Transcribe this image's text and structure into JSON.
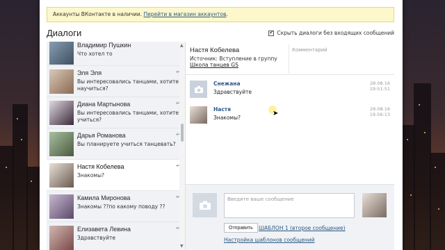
{
  "notice": {
    "text": "Аккаунты ВКонтакте в наличии. ",
    "link": "Перейти в магазин аккаунтов",
    "tail": "."
  },
  "header": {
    "title": "Диалоги",
    "hide_toggle_label": "Скрыть диалоги без входящих сообщений",
    "hide_toggle_checked": true
  },
  "dialogs": [
    {
      "name": "Владимир Пушкин",
      "preview": "Что хотел то",
      "reply_icon": false
    },
    {
      "name": "Эля Эля",
      "preview": "Вы интересовались танцами, хотите научиться?",
      "reply_icon": true
    },
    {
      "name": "Диана Мартынова",
      "preview": "Вы интересовались танцами, хотите учиться?",
      "reply_icon": true
    },
    {
      "name": "Дарья Романова",
      "preview": "Вы планируете учиться танцевать?",
      "reply_icon": true
    },
    {
      "name": "Настя Кобелева",
      "preview": "Знакомы?",
      "reply_icon": true,
      "active": true
    },
    {
      "name": "Камила Миронова",
      "preview": "Знакомы ??по какому поводу ??",
      "reply_icon": true
    },
    {
      "name": "Елизавета Левина",
      "preview": "Здравствуйте",
      "reply_icon": true
    }
  ],
  "conversation": {
    "contact_name": "Настя Кобелева",
    "source_prefix": "Источник: Вступление в группу ",
    "source_link": "Школа танцев GS",
    "comment_placeholder": "Комментарий",
    "messages": [
      {
        "author": "Снежана",
        "text": "Здравствуйте",
        "date": "28.08.16",
        "time": "19:51:51"
      },
      {
        "author": "Настя",
        "text": "Знакомы?",
        "date": "28.08.16",
        "time": "19:56:13"
      }
    ]
  },
  "composer": {
    "placeholder": "Введите ваше сообщение",
    "send_label": "Отправить",
    "template_link": "ШАБЛОН 1 (второе сообщение)",
    "template_settings_link": "Настройка шаблонов сообщений"
  },
  "icons": {
    "camera": "camera-icon",
    "reply": "reply-arrow-icon",
    "check": "checkmark-icon"
  },
  "colors": {
    "link": "#2a5885",
    "notice_bg": "#fdf7cc",
    "active_dialog_bg": "#ffffff",
    "dialog_bg": "#f0f2f5"
  }
}
